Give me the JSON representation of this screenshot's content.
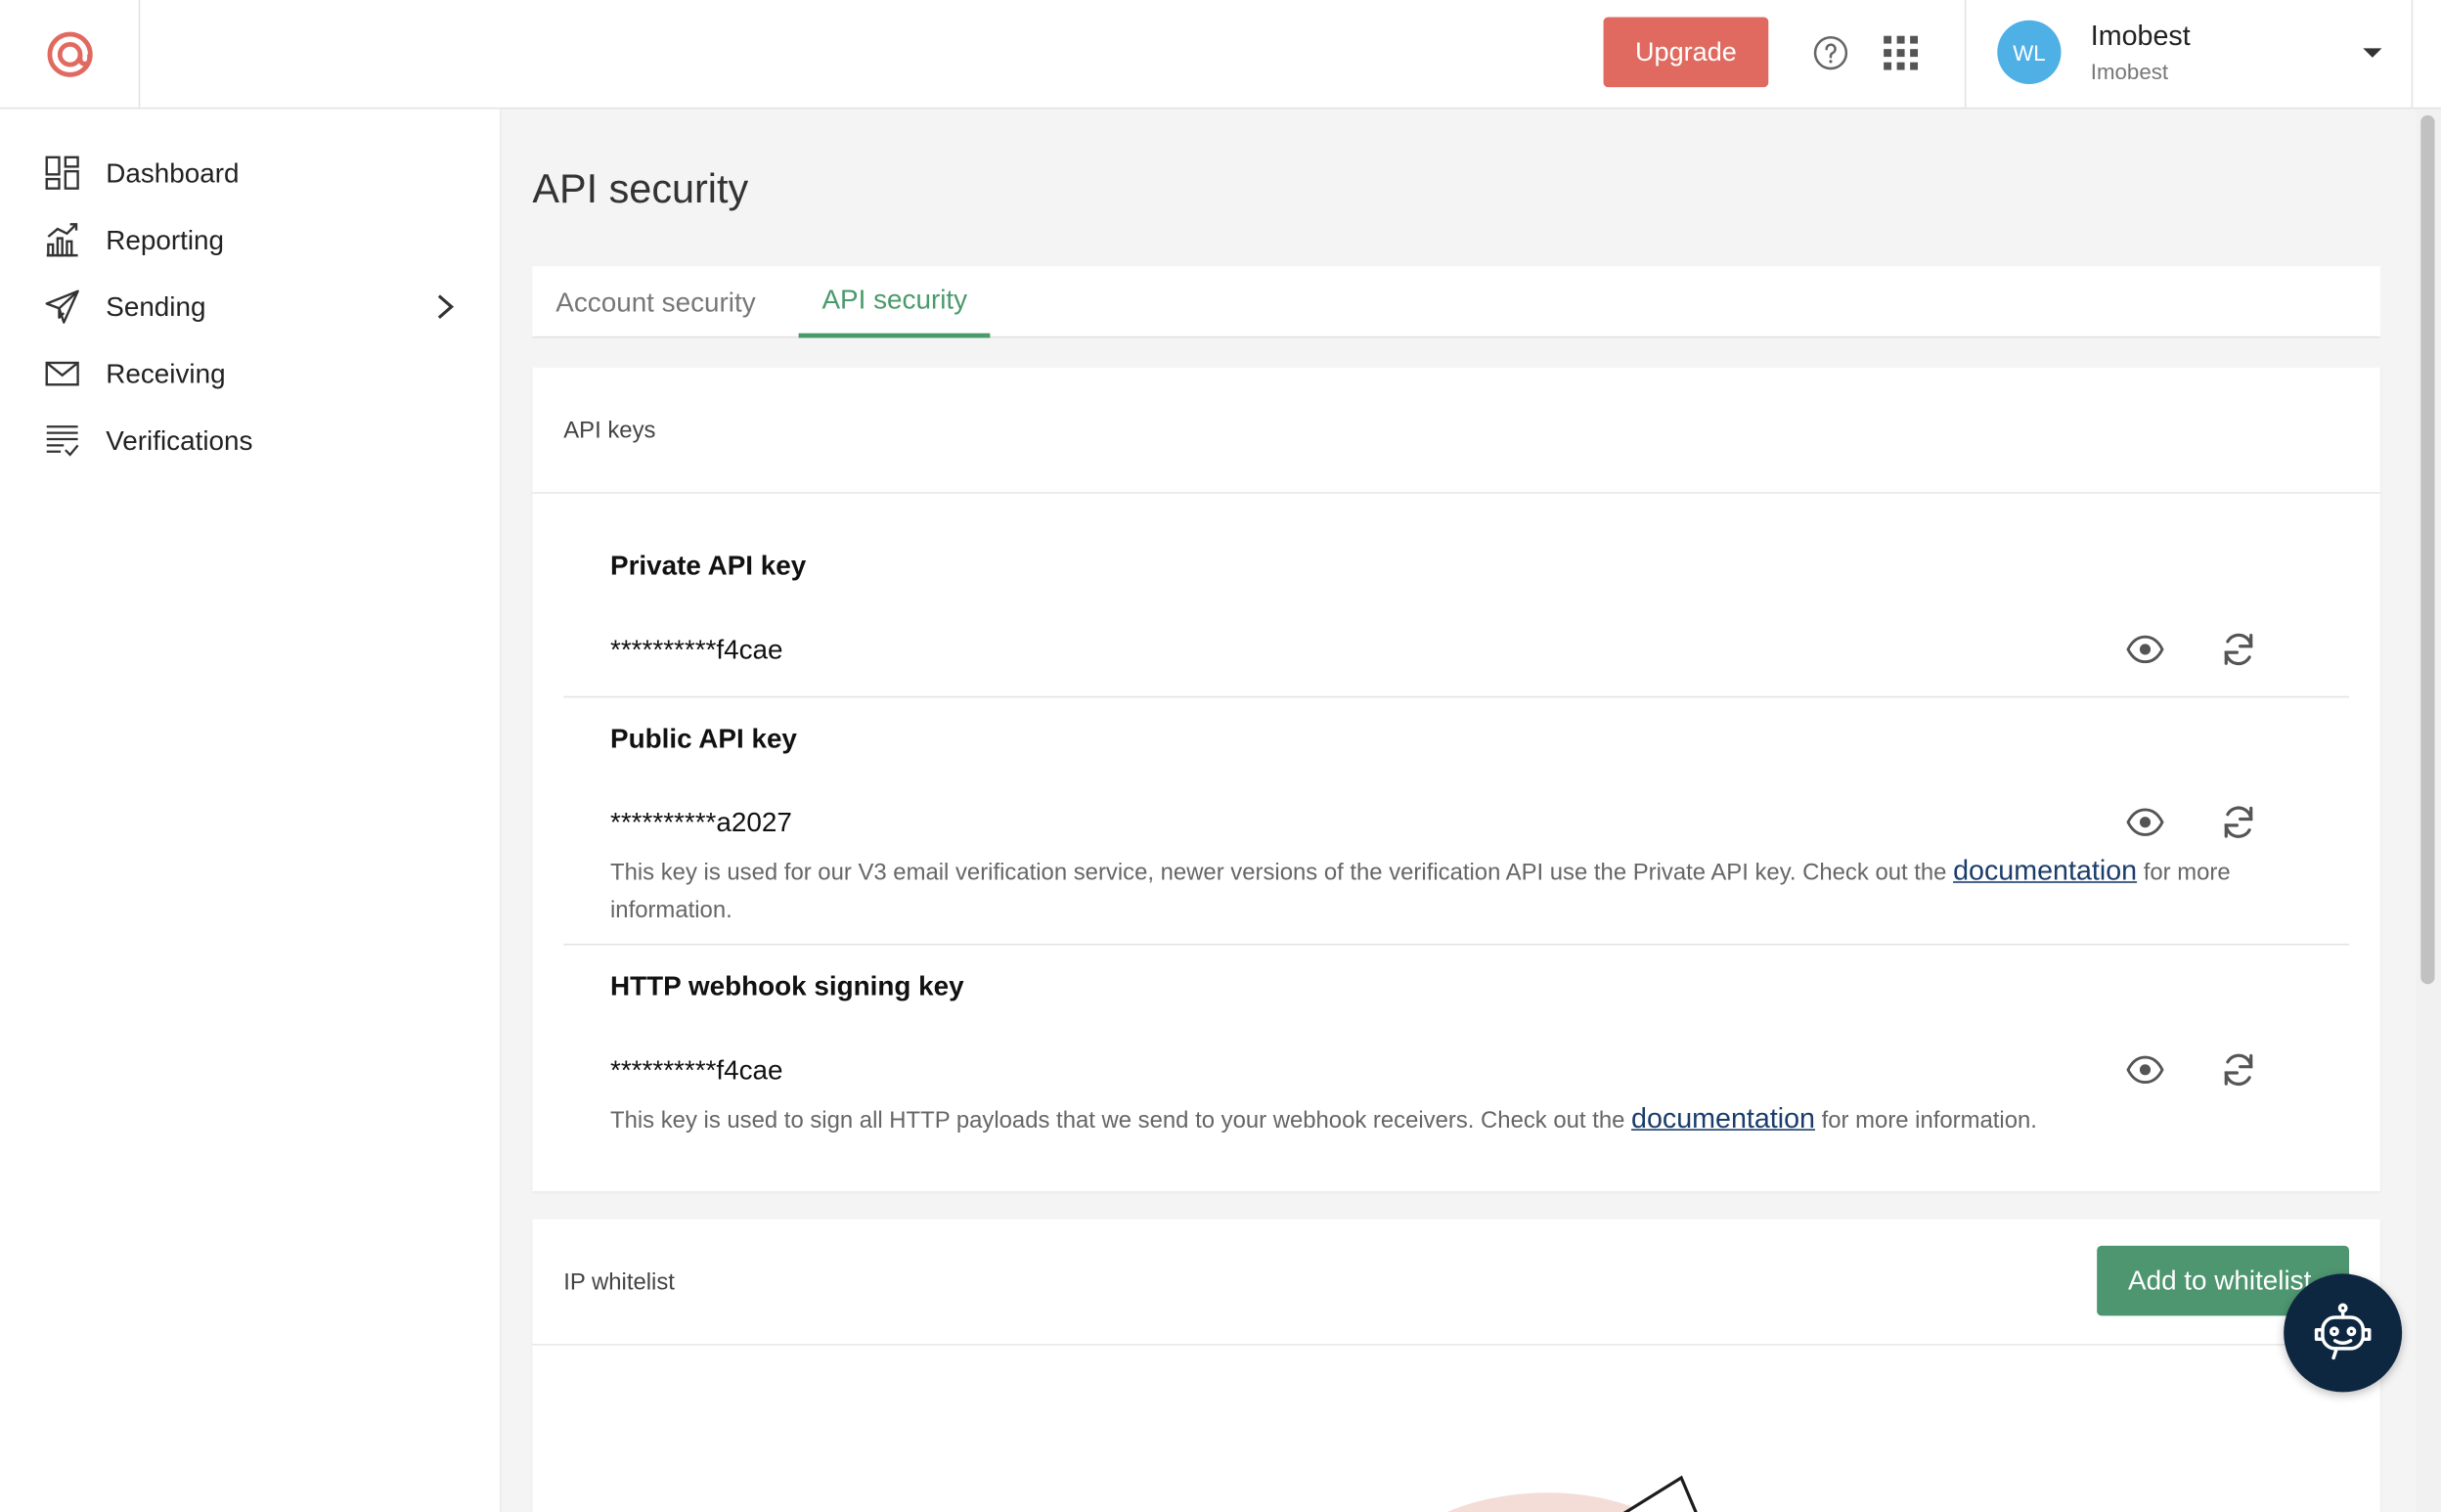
{
  "topbar": {
    "upgrade_label": "Upgrade",
    "user": {
      "initials": "WL",
      "name": "Imobest",
      "account": "Imobest"
    }
  },
  "sidebar": {
    "items": [
      {
        "label": "Dashboard",
        "icon": "dashboard-icon"
      },
      {
        "label": "Reporting",
        "icon": "reporting-icon"
      },
      {
        "label": "Sending",
        "icon": "sending-icon"
      },
      {
        "label": "Receiving",
        "icon": "receiving-icon"
      },
      {
        "label": "Verifications",
        "icon": "verifications-icon"
      }
    ]
  },
  "page": {
    "title": "API security",
    "tabs": [
      {
        "label": "Account security",
        "active": false
      },
      {
        "label": "API security",
        "active": true
      }
    ]
  },
  "api_keys": {
    "heading": "API keys",
    "keys": [
      {
        "title": "Private API key",
        "value": "**********f4cae"
      },
      {
        "title": "Public API key",
        "value": "**********a2027",
        "desc_before": "This key is used for our V3 email verification service, newer versions of the verification API use the Private API key. Check out the ",
        "link": "documentation",
        "desc_after": " for more information."
      },
      {
        "title": "HTTP webhook signing key",
        "value": "**********f4cae",
        "desc_before": "This key is used to sign all HTTP payloads that we send to your webhook receivers. Check out the ",
        "link": "documentation",
        "desc_after": " for more information."
      }
    ]
  },
  "ip_whitelist": {
    "heading": "IP whitelist",
    "add_label": "Add to whitelist"
  },
  "colors": {
    "accent_green": "#4a9a6c",
    "upgrade_red": "#e06a60",
    "avatar_blue": "#4fb0e6",
    "bot_navy": "#0e2741"
  }
}
